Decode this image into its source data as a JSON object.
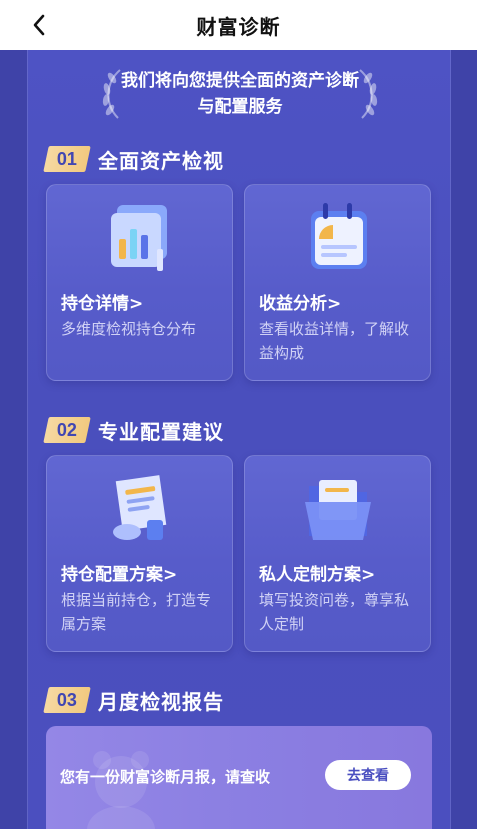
{
  "header": {
    "title": "财富诊断",
    "back_icon": "back-arrow-icon"
  },
  "intro": {
    "text": "我们将向您提供全面的资产诊断与配置服务"
  },
  "sections": [
    {
      "number": "01",
      "title": "全面资产检视",
      "cards": [
        {
          "title": "持仓详情>",
          "desc": "多维度检视持仓分布",
          "icon": "chart-icon"
        },
        {
          "title": "收益分析>",
          "desc": "查看收益详情，了解收益构成",
          "icon": "calendar-icon"
        }
      ]
    },
    {
      "number": "02",
      "title": "专业配置建议",
      "cards": [
        {
          "title": "持仓配置方案>",
          "desc": "根据当前持仓，打造专属方案",
          "icon": "document-icon"
        },
        {
          "title": "私人定制方案>",
          "desc": "填写投资问卷，尊享私人定制",
          "icon": "folder-icon"
        }
      ]
    },
    {
      "number": "03",
      "title": "月度检视报告"
    }
  ],
  "report": {
    "text": "您有一份财富诊断月报，请查收",
    "button_label": "去查看"
  },
  "colors": {
    "background": "#3f43a8",
    "panel": "#4e53c4",
    "card": "#5b60cd",
    "badge": "#f4d08f",
    "report_card": "#8f83e4"
  }
}
